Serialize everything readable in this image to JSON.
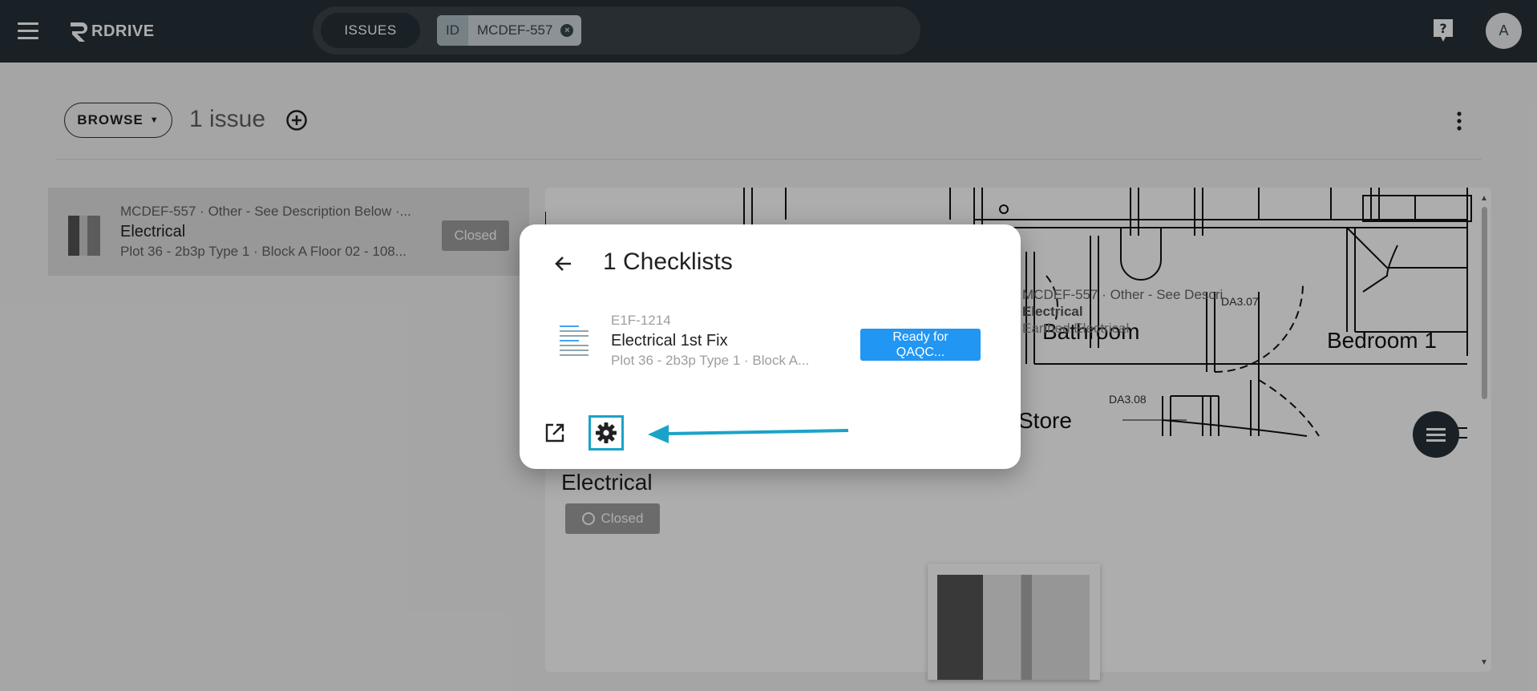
{
  "topbar": {
    "logo_text": "RDRIVE",
    "issues_chip": "ISSUES",
    "filter_label": "ID",
    "filter_value": "MCDEF-557",
    "avatar_initial": "A"
  },
  "toolbar": {
    "browse_label": "BROWSE",
    "issue_count": "1 issue"
  },
  "issue_list": [
    {
      "line1": "MCDEF-557 · Other - See Description Below ·...",
      "title": "Electrical",
      "location": "Plot 36 - 2b3p Type 1 · Block A Floor 02 - 108...",
      "status": "Closed"
    }
  ],
  "plan": {
    "rooms": [
      "Bathroom",
      "Bedroom 1",
      "Store"
    ],
    "tags": [
      "DA3.07",
      "DA3.08"
    ],
    "overlay_line1": "MCDEF-557 · Other - See Descri",
    "overlay_line2": "Electrical",
    "overlay_line3": "Earthed Electrical"
  },
  "detail": {
    "title": "Electrical",
    "status": "Closed"
  },
  "dialog": {
    "title": "1 Checklists",
    "checklist": {
      "code": "E1F-1214",
      "name": "Electrical 1st Fix",
      "location": "Plot 36 - 2b3p Type 1 · Block A...",
      "status_line1": "Ready for",
      "status_line2": "QAQC..."
    }
  },
  "colors": {
    "topbar": "#263238",
    "status_blue": "#2196f3",
    "highlight": "#1aa3c8",
    "closed_grey": "#9e9e9e"
  }
}
